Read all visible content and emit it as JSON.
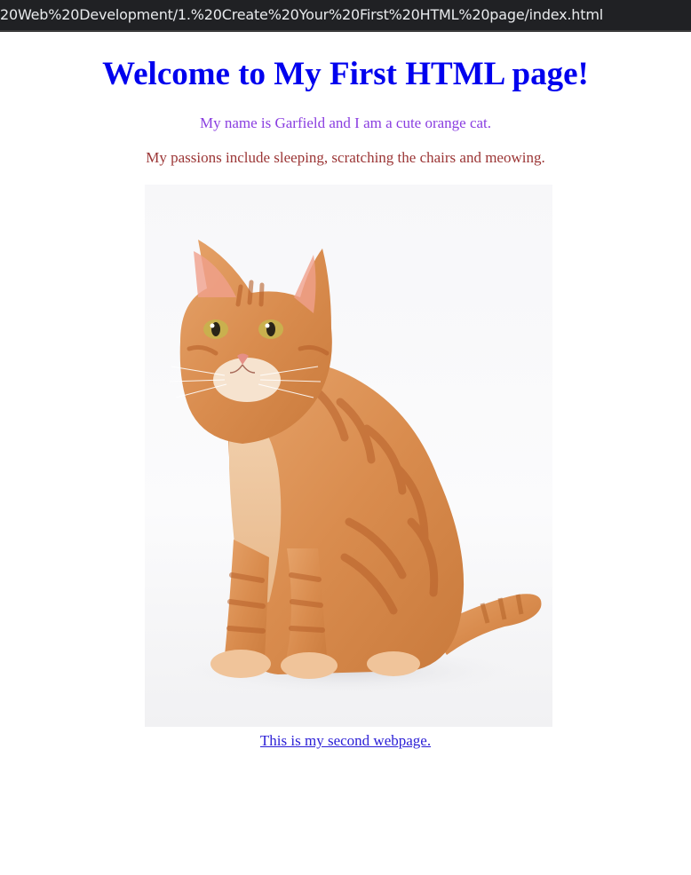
{
  "browser": {
    "address": "20Web%20Development/1.%20Create%20Your%20First%20HTML%20page/index.html"
  },
  "page": {
    "heading": "Welcome to My First HTML page!",
    "intro": "My name is Garfield and I am a cute orange cat.",
    "passions": "My passions include sleeping, scratching the chairs and meowing.",
    "image": {
      "subject": "orange-tabby-cat-sitting"
    },
    "link_text": "This is my second webpage."
  },
  "colors": {
    "heading": "#0000ee",
    "intro": "#8a3ee0",
    "passions": "#9b3535",
    "link": "#2a1ed6"
  }
}
